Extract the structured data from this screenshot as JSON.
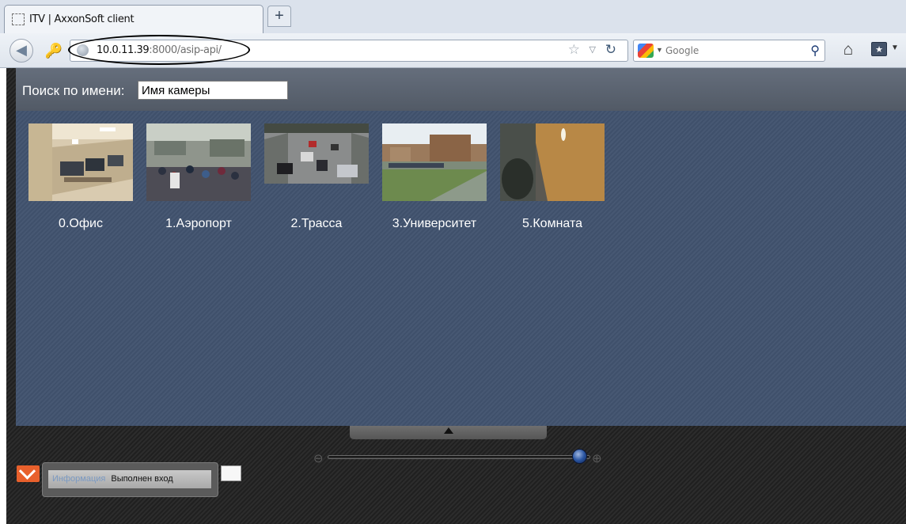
{
  "browser": {
    "tab_title": "ITV | AxxonSoft client",
    "new_tab_label": "+",
    "url_host": "10.0.11.39",
    "url_rest": ":8000/asip-api/",
    "search_placeholder": "Google"
  },
  "search": {
    "label": "Поиск по имени:",
    "value": "Имя камеры"
  },
  "cameras": [
    {
      "label": "0.Офис"
    },
    {
      "label": "1.Аэропорт"
    },
    {
      "label": "2.Трасса"
    },
    {
      "label": "3.Университет"
    },
    {
      "label": "5.Комната"
    }
  ],
  "status": {
    "key": "Информация",
    "value": "Выполнен вход"
  },
  "zoom": {
    "level": 1.0
  },
  "icons": [
    "globe-icon",
    "back-arrow-icon",
    "star-icon",
    "reload-icon",
    "search-icon",
    "home-icon",
    "bookmarks-icon",
    "zoom-out-icon",
    "zoom-in-icon",
    "mail-icon"
  ]
}
